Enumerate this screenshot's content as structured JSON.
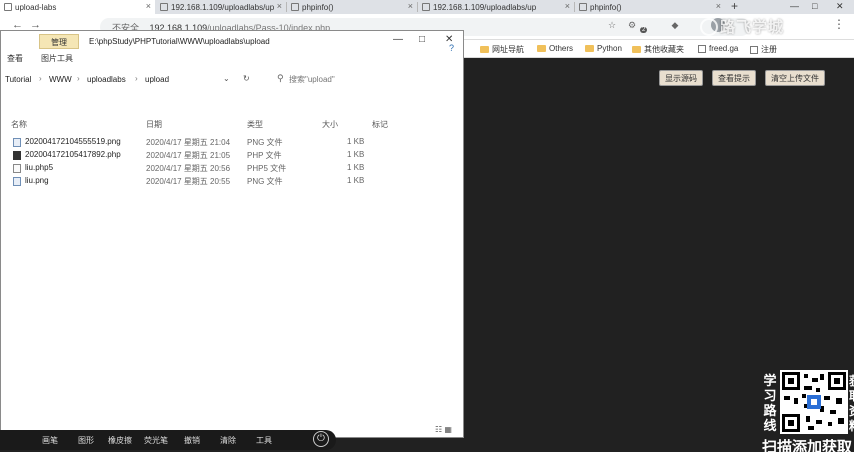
{
  "browser": {
    "tabs": [
      {
        "title": "upload-labs",
        "active": true
      },
      {
        "title": "192.168.1.109/uploadlabs/up",
        "active": false
      },
      {
        "title": "phpinfo()",
        "active": false
      },
      {
        "title": "192.168.1.109/uploadlabs/up",
        "active": false
      },
      {
        "title": "phpinfo()",
        "active": false
      }
    ],
    "new_tab": "+",
    "url": {
      "security": "不安全",
      "host": "192.168.1.109",
      "path": "/uploadlabs/Pass-10/index.php"
    },
    "extension_badge": "2",
    "bookmarks": [
      {
        "label": "网址导航",
        "icon": "folder-icon"
      },
      {
        "label": "Others",
        "icon": "folder-icon"
      },
      {
        "label": "Python",
        "icon": "folder-icon"
      },
      {
        "label": "其他收藏夹",
        "icon": "folder-icon"
      },
      {
        "label": "freed.ga",
        "icon": "page-icon"
      },
      {
        "label": "注册",
        "icon": "page-icon"
      }
    ],
    "page_buttons": [
      "显示源码",
      "查看提示",
      "清空上传文件"
    ]
  },
  "explorer": {
    "manage_tab": "管理",
    "path": "E:\\phpStudy\\PHPTutorial\\WWW\\uploadlabs\\upload",
    "ribbon": {
      "view": "查看",
      "picture_tools": "图片工具"
    },
    "breadcrumbs": [
      "Tutorial",
      "WWW",
      "uploadlabs",
      "upload"
    ],
    "search_placeholder": "搜索\"upload\"",
    "columns": {
      "name": "名称",
      "date": "日期",
      "type": "类型",
      "size": "大小",
      "tags": "标记"
    },
    "files": [
      {
        "name": "202004172104555519.png",
        "date": "2020/4/17 星期五 21:04",
        "type": "PNG 文件",
        "size": "1 KB",
        "icon": "png"
      },
      {
        "name": "202004172105417892.php",
        "date": "2020/4/17 星期五 21:05",
        "type": "PHP 文件",
        "size": "1 KB",
        "icon": "php"
      },
      {
        "name": "liu.php5",
        "date": "2020/4/17 星期五 20:56",
        "type": "PHP5 文件",
        "size": "1 KB",
        "icon": "file"
      },
      {
        "name": "liu.png",
        "date": "2020/4/17 星期五 20:55",
        "type": "PNG 文件",
        "size": "1 KB",
        "icon": "png"
      }
    ]
  },
  "taskbar": {
    "items": [
      "画笔",
      "图形",
      "橡皮擦",
      "荧光笔",
      "撤销",
      "清除",
      "工具"
    ],
    "power": "⏻"
  },
  "promo": {
    "side": [
      "学",
      "习",
      "路",
      "线"
    ],
    "bottom": "扫描添加获取",
    "right": [
      "获",
      "取",
      "资",
      "料"
    ],
    "watermark": "路飞学城"
  }
}
